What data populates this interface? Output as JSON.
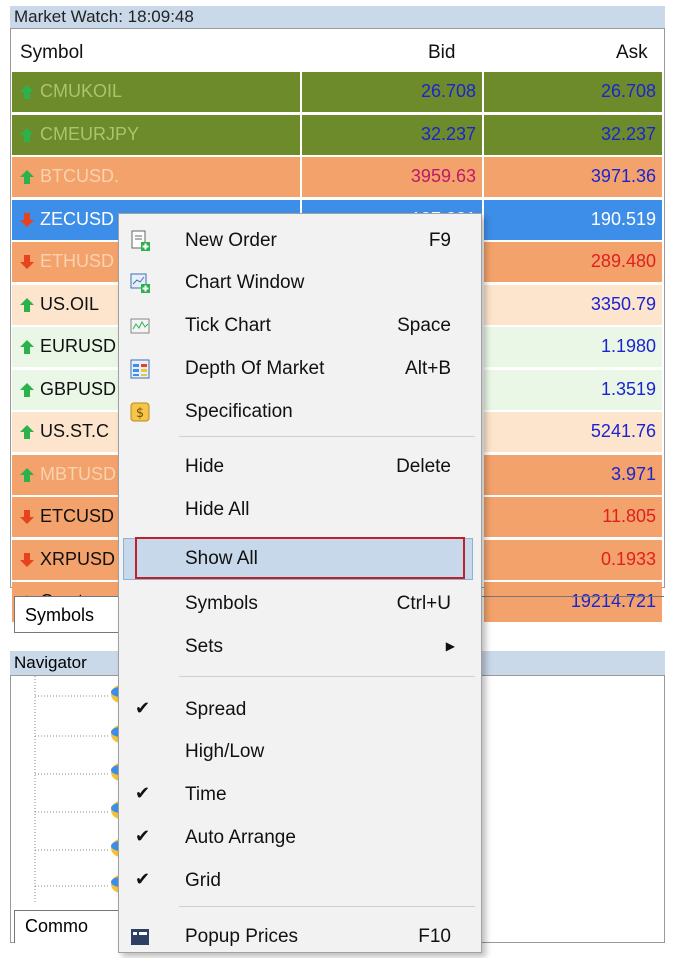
{
  "market_watch": {
    "title": "Market Watch: 18:09:48",
    "headers": {
      "symbol": "Symbol",
      "bid": "Bid",
      "ask": "Ask"
    },
    "rows": [
      {
        "symbol": "CMUKOIL",
        "bid": "26.708",
        "ask": "26.708",
        "dir": "up",
        "bg": "#6d8b2a",
        "sym_color": "#a9c56e",
        "bid_color": "#1a24d0",
        "ask_color": "#1a24d0"
      },
      {
        "symbol": "CMEURJPY",
        "bid": "32.237",
        "ask": "32.237",
        "dir": "up",
        "bg": "#6d8b2a",
        "sym_color": "#a9c56e",
        "bid_color": "#1a24d0",
        "ask_color": "#1a24d0"
      },
      {
        "symbol": "BTCUSD.",
        "bid": "3959.63",
        "ask": "3971.36",
        "dir": "up",
        "bg": "#f2a26a",
        "sym_color": "#f9d2b2",
        "bid_color": "#c0186a",
        "ask_color": "#1a24d0"
      },
      {
        "symbol": "ZECUSD",
        "bid": "187.231",
        "ask": "190.519",
        "dir": "down",
        "bg": "#3d8ee8",
        "sym_color": "#ffffff",
        "bid_color": "#ffffff",
        "ask_color": "#ffffff"
      },
      {
        "symbol": "ETHUSD",
        "bid": "",
        "ask": "289.480",
        "dir": "down",
        "bg": "#f2a26a",
        "sym_color": "#f9d2b2",
        "bid_color": "#e02020",
        "ask_color": "#e02020"
      },
      {
        "symbol": "US.OIL",
        "bid": "",
        "ask": "3350.79",
        "dir": "up",
        "bg": "#fde4cc",
        "sym_color": "#111111",
        "bid_color": "#1a24d0",
        "ask_color": "#1a24d0"
      },
      {
        "symbol": "EURUSD",
        "bid": "",
        "ask": "1.1980",
        "dir": "up",
        "bg": "#eaf7e6",
        "sym_color": "#111111",
        "bid_color": "#1a24d0",
        "ask_color": "#1a24d0"
      },
      {
        "symbol": "GBPUSD",
        "bid": "",
        "ask": "1.3519",
        "dir": "up",
        "bg": "#eaf7e6",
        "sym_color": "#111111",
        "bid_color": "#1a24d0",
        "ask_color": "#1a24d0"
      },
      {
        "symbol": "US.ST.C",
        "bid": "",
        "ask": "5241.76",
        "dir": "up",
        "bg": "#fde4cc",
        "sym_color": "#111111",
        "bid_color": "#1a24d0",
        "ask_color": "#1a24d0"
      },
      {
        "symbol": "MBTUSD",
        "bid": "",
        "ask": "3.971",
        "dir": "up",
        "bg": "#f2a26a",
        "sym_color": "#f9d2b2",
        "bid_color": "#1a24d0",
        "ask_color": "#1a24d0"
      },
      {
        "symbol": "ETCUSD",
        "bid": "",
        "ask": "11.805",
        "dir": "down",
        "bg": "#f2a26a",
        "sym_color": "#111111",
        "bid_color": "#e02020",
        "ask_color": "#e02020"
      },
      {
        "symbol": "XRPUSD",
        "bid": "",
        "ask": "0.1933",
        "dir": "down",
        "bg": "#f2a26a",
        "sym_color": "#111111",
        "bid_color": "#e02020",
        "ask_color": "#e02020"
      },
      {
        "symbol": "Crypto",
        "bid": "",
        "ask": "19214.721",
        "dir": "up",
        "bg": "#f2a26a",
        "sym_color": "#111111",
        "bid_color": "#1a24d0",
        "ask_color": "#1a24d0"
      }
    ],
    "tab_symbols": "Symbols"
  },
  "navigator": {
    "title": "Navigator",
    "tab_common": "Commo"
  },
  "context_menu": {
    "items": [
      {
        "label": "New Order",
        "shortcut": "F9",
        "icon": "new-order-icon"
      },
      {
        "label": "Chart Window",
        "shortcut": "",
        "icon": "chart-window-icon"
      },
      {
        "label": "Tick Chart",
        "shortcut": "Space",
        "icon": "tick-chart-icon"
      },
      {
        "label": "Depth Of Market",
        "shortcut": "Alt+B",
        "icon": "depth-of-market-icon"
      },
      {
        "label": "Specification",
        "shortcut": "",
        "icon": "specification-icon"
      },
      {
        "label": "Hide",
        "shortcut": "Delete"
      },
      {
        "label": "Hide All",
        "shortcut": ""
      },
      {
        "label": "Show All",
        "shortcut": ""
      },
      {
        "label": "Symbols",
        "shortcut": "Ctrl+U"
      },
      {
        "label": "Sets",
        "shortcut": ""
      },
      {
        "label": "Spread",
        "shortcut": "",
        "checked": true
      },
      {
        "label": "High/Low",
        "shortcut": ""
      },
      {
        "label": "Time",
        "shortcut": "",
        "checked": true
      },
      {
        "label": "Auto Arrange",
        "shortcut": "",
        "checked": true
      },
      {
        "label": "Grid",
        "shortcut": "",
        "checked": true
      },
      {
        "label": "Popup Prices",
        "shortcut": "F10",
        "icon": "popup-prices-icon"
      }
    ]
  },
  "colors": {
    "title_bar": "#c9d9ea",
    "menu_highlight": "#c6d8ea",
    "annotation_box": "#c0202a"
  }
}
